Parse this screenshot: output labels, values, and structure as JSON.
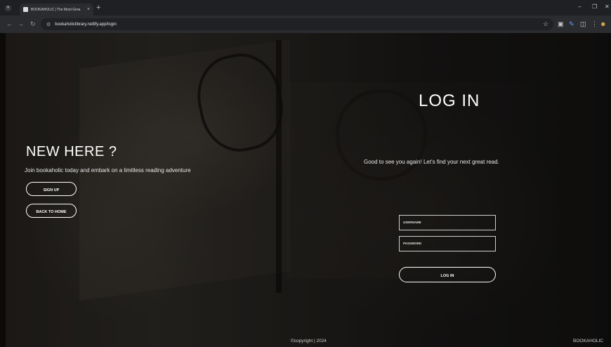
{
  "browser": {
    "tab_title": "BOOKAHOLIC | The Most Grea",
    "tab_close": "×",
    "new_tab": "+",
    "tab_menu": "▾",
    "url": "bookaholiclibrary.netlify.app/login",
    "minimize": "–",
    "restore": "❐",
    "close": "✕",
    "back_icon": "←",
    "forward_icon": "→",
    "reload_icon": "↻",
    "tune_icon": "⚙",
    "star_icon": "☆",
    "extension_icon": "▣",
    "pen_icon": "✎",
    "puzzle_icon": "◫",
    "menu_icon": "⋮",
    "profile_icon": "☻"
  },
  "signup_panel": {
    "title": "NEW HERE ?",
    "subtitle": "Join bookaholic today and embark on a limitless reading adventure",
    "signup_label": "SIGN UP",
    "home_label": "BACK TO HOME"
  },
  "login_panel": {
    "title": "LOG IN",
    "subtitle": "Good to see you again! Let's find your next great read.",
    "username_placeholder": "USERNAME",
    "password_placeholder": "PASSWORD",
    "login_label": "LOG IN"
  },
  "footer": {
    "copyright": "©copyright | 2024",
    "brand": "BOOKAHOLIC"
  }
}
